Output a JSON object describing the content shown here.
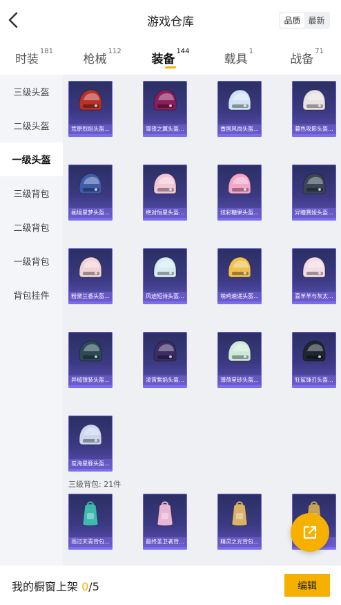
{
  "header": {
    "title": "游戏仓库",
    "sort": [
      "品质",
      "最新"
    ]
  },
  "tabs": [
    {
      "label": "时装",
      "count": "181"
    },
    {
      "label": "枪械",
      "count": "112"
    },
    {
      "label": "装备",
      "count": "144"
    },
    {
      "label": "载具",
      "count": "1"
    },
    {
      "label": "战备",
      "count": "71"
    }
  ],
  "sidebar": [
    "三级头盔",
    "二级头盔",
    "一级头盔",
    "三级背包",
    "二级背包",
    "一级背包",
    "背包挂件"
  ],
  "helmets": [
    {
      "name": "荒原烈焰头盔...",
      "color": "#b8322a"
    },
    {
      "name": "霏夜之翼头盔...",
      "color": "#8a1f5c"
    },
    {
      "name": "香国风尚头盔...",
      "color": "#cfe3f4"
    },
    {
      "name": "暮色攻影头盔...",
      "color": "#e9e1e4"
    },
    {
      "name": "画境星梦头盔...",
      "color": "#3f5ca8"
    },
    {
      "name": "绝对恒星头盔...",
      "color": "#f1c8d8"
    },
    {
      "name": "炫彩糖果头盔...",
      "color": "#f3a6c9"
    },
    {
      "name": "异瞳赛娅头盔...",
      "color": "#3a4656"
    },
    {
      "name": "粉黛兰香头盔...",
      "color": "#f1d2d6"
    },
    {
      "name": "风迹短诗头盔...",
      "color": "#d8ecf4"
    },
    {
      "name": "萌鸡速递头盔...",
      "color": "#f2c04e"
    },
    {
      "name": "喜羊羊与灰太...",
      "color": "#f4dce4"
    },
    {
      "name": "异械银装头盔...",
      "color": "#2c4a56"
    },
    {
      "name": "凌霄紫焰头盔...",
      "color": "#3b2d63"
    },
    {
      "name": "薄荷星砂头盔...",
      "color": "#cfe9d8"
    },
    {
      "name": "狂鲨锋刃头盔...",
      "color": "#1e2630"
    },
    {
      "name": "炭海星豚头盔...",
      "color": "#c9d6ee"
    }
  ],
  "backpack_section": "三级背包: 21件",
  "backpacks": [
    {
      "name": "雨过天青背包...",
      "color": "#3fb8b0"
    },
    {
      "name": "最终圣卫者背...",
      "color": "#e9b6d6"
    },
    {
      "name": "精灵之光背包...",
      "color": "#d9b26a"
    },
    {
      "name": "",
      "color": "#c9a35a"
    }
  ],
  "footer": {
    "label": "我的橱窗上架",
    "current": "0",
    "total": "/5",
    "edit": "编辑"
  },
  "accent": "#f6b100"
}
